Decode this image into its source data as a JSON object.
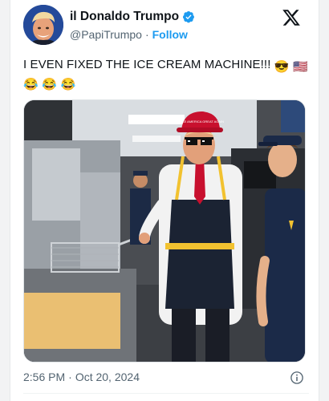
{
  "post": {
    "display_name": "il Donaldo Trumpo",
    "handle": "@PapiTrumpo",
    "separator": "·",
    "follow_label": "Follow",
    "text_line1": "I EVEN FIXED THE ICE CREAM MACHINE!!!",
    "emoji_sunglasses": "😎",
    "emoji_flag": "🇺🇸",
    "emoji_laugh": "😂",
    "time": "2:56 PM",
    "date": "Oct 20, 2024",
    "hat_text": "MAKE AMERICA GREAT AGAIN"
  },
  "icons": {
    "brand": "x-logo-icon",
    "verified": "verified-badge-icon",
    "info": "info-icon"
  },
  "colors": {
    "accent": "#1d9bf0",
    "text": "#0f1419",
    "secondary": "#536471"
  }
}
